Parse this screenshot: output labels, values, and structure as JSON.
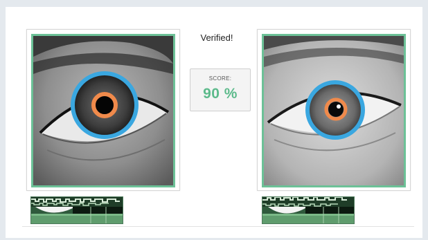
{
  "verification": {
    "status": "Verified!",
    "score_label": "SCORE:",
    "score_value": "90 %",
    "score_fraction": 0.9
  },
  "images": {
    "left": {
      "icon": "left-eye-iris-scan"
    },
    "right": {
      "icon": "right-eye-iris-scan"
    }
  },
  "colors": {
    "frame_green": "#6cc197",
    "score_green": "#5cba8b",
    "iris_ring_blue": "#3aa7e0",
    "pupil_ring_orange": "#f08a4b"
  }
}
